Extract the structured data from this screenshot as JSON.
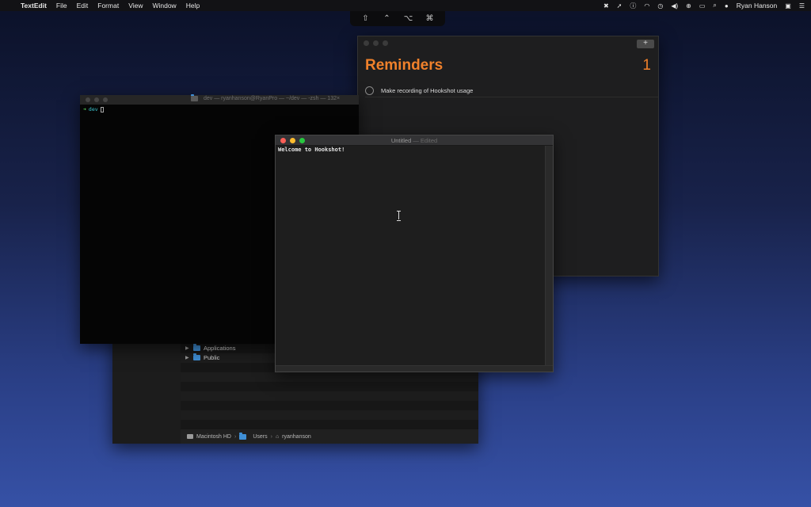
{
  "menubar": {
    "app_name": "TextEdit",
    "items": [
      "File",
      "Edit",
      "Format",
      "View",
      "Window",
      "Help"
    ],
    "user": "Ryan Hanson"
  },
  "modifier_keys": [
    "⇧",
    "⌃",
    "⌥",
    "⌘"
  ],
  "reminders": {
    "title": "Reminders",
    "count": "1",
    "item": "Make recording of Hookshot usage"
  },
  "terminal": {
    "title": "dev — ryanhanson@RyanPro — ~/dev — -zsh — 132×",
    "prompt_dir": "dev"
  },
  "textedit": {
    "title": "Untitled",
    "edited": " — Edited",
    "content": "Welcome to Hookshot!"
  },
  "finder": {
    "rows": [
      "Applications",
      "Public"
    ],
    "path": [
      "Macintosh HD",
      "Users",
      "ryanhanson"
    ]
  }
}
